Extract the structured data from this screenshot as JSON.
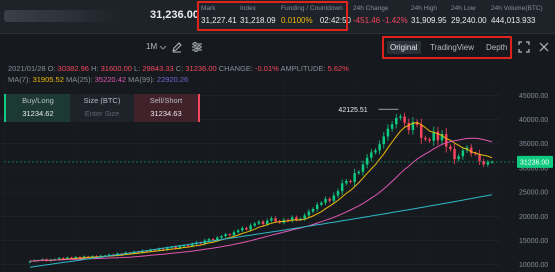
{
  "ticker": {
    "last_price": "31,236.00",
    "mark": {
      "label": "Mark",
      "value": "31,227.41"
    },
    "index": {
      "label": "Index",
      "value": "31,218.09"
    },
    "funding": {
      "label": "Funding / Countdown",
      "rate": "0.0100%",
      "countdown": "02:42:50"
    },
    "change": {
      "label": "24h Change",
      "value": "-451.46 -1.42%"
    },
    "high": {
      "label": "24h High",
      "value": "31,909.95"
    },
    "low": {
      "label": "24h Low",
      "value": "29,240.00"
    },
    "volume": {
      "label": "24h Volume(BTC)",
      "value": "444,013.933"
    }
  },
  "toolbar": {
    "interval": "1M",
    "views": [
      "Original",
      "TradingView",
      "Depth"
    ],
    "active_view": "Original",
    "icons": [
      "interval-dropdown-icon",
      "draw-pencil-icon",
      "settings-sliders-icon",
      "fullscreen-icon",
      "close-icon"
    ]
  },
  "ohlc": {
    "date": "2021/01/28",
    "o_label": "O:",
    "o": "30382.96",
    "h_label": "H:",
    "h": "31600.00",
    "l_label": "L:",
    "l": "29843.33",
    "c_label": "C:",
    "c": "31236.00",
    "change_label": "CHANGE:",
    "change": "-0.01%",
    "amp_label": "AMPLITUDE:",
    "amplitude": "5.62%"
  },
  "ma": {
    "ma7_label": "MA(7):",
    "ma7": "31905.52",
    "ma25_label": "MA(25):",
    "ma25": "35220.42",
    "ma99_label": "MA(99):",
    "ma99": "22920.26"
  },
  "trade_panel": {
    "buy_label": "Buy/Long",
    "buy_price": "31234.62",
    "size_label": "Size (BTC)",
    "size_placeholder": "Enter Size",
    "sell_label": "Sell/Short",
    "sell_price": "31234.63"
  },
  "chart_data": {
    "type": "candlestick",
    "high_marker": "42125.51",
    "current_price_label": "31236.00",
    "y_ticks": [
      "45000.00",
      "40000.00",
      "35000.00",
      "30000.00",
      "25000.00",
      "20000.00",
      "15000.00",
      "10000.00"
    ],
    "ylim": [
      8500,
      46500
    ],
    "candles_close": [
      10700,
      10900,
      10950,
      11100,
      10800,
      11050,
      11150,
      11400,
      11200,
      11500,
      11300,
      11600,
      11450,
      11700,
      11650,
      11800,
      11550,
      11850,
      11900,
      12100,
      11950,
      12300,
      12200,
      12500,
      12400,
      12700,
      12550,
      12900,
      12800,
      13100,
      13000,
      13300,
      13150,
      13500,
      13700,
      13400,
      13800,
      14000,
      13900,
      14300,
      14600,
      14400,
      15000,
      15300,
      15100,
      15600,
      15900,
      16300,
      16100,
      16700,
      17100,
      17600,
      17300,
      18100,
      18500,
      18900,
      18400,
      19100,
      19600,
      19000,
      18700,
      19300,
      19100,
      19800,
      19300,
      19500,
      20200,
      21000,
      21500,
      22400,
      22800,
      23600,
      23200,
      24300,
      25200,
      26800,
      27300,
      27100,
      28900,
      29200,
      30700,
      32100,
      33200,
      33600,
      34900,
      36500,
      38100,
      39000,
      40300,
      40600,
      39300,
      37800,
      39500,
      38900,
      36200,
      35900,
      35600,
      37500,
      35700,
      37000,
      34400,
      33900,
      31800,
      32400,
      33600,
      34200,
      33000,
      32900,
      31400,
      30700,
      31200,
      31236
    ],
    "colors": {
      "up": "#0ecb81",
      "down": "#f6465d",
      "ma7": "#f0b90b",
      "ma25": "#e256b2",
      "ma99": "#2fb8c8"
    }
  }
}
